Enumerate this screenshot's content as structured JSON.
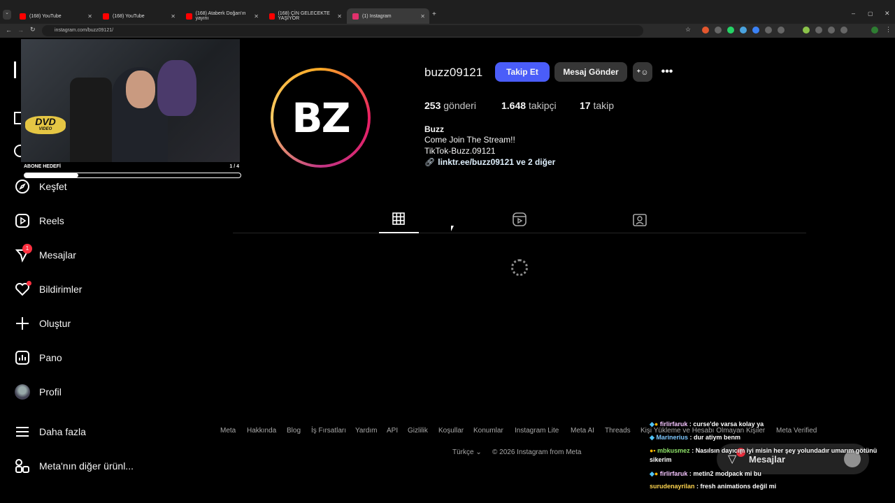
{
  "browser": {
    "tabs": [
      {
        "title": "(168) YouTube",
        "color": "#ff0000"
      },
      {
        "title": "(168) YouTube",
        "color": "#ff0000"
      },
      {
        "title": "(168) Ataberk Doğan'ın yayını",
        "color": "#ff0000"
      },
      {
        "title": "(168) ÇİN GELECEKTE YAŞIYOR",
        "color": "#ff0000"
      },
      {
        "title": "(1) Instagram",
        "color": "#e1306c"
      }
    ],
    "url": "instagram.com/buzz09121/"
  },
  "stream": {
    "dvd_label": "DVD",
    "dvd_sub": "VIDEO",
    "goal_label": "ABONE HEDEFİ",
    "goal_count": "1 / 4",
    "goal_progress": 0.25
  },
  "sidebar": {
    "items": [
      {
        "label": "Keşfet",
        "icon": "compass-icon"
      },
      {
        "label": "Reels",
        "icon": "reels-icon"
      },
      {
        "label": "Mesajlar",
        "icon": "messenger-icon",
        "badge": "1"
      },
      {
        "label": "Bildirimler",
        "icon": "heart-icon"
      },
      {
        "label": "Oluştur",
        "icon": "plus-icon"
      },
      {
        "label": "Pano",
        "icon": "dashboard-icon"
      },
      {
        "label": "Profil",
        "icon": "avatar"
      },
      {
        "label": "Daha fazla",
        "icon": "menu-icon"
      },
      {
        "label": "Meta'nın diğer ürünl...",
        "icon": "apps-icon"
      }
    ]
  },
  "profile": {
    "username": "buzz09121",
    "avatar_text": "BZ",
    "follow_label": "Takip Et",
    "message_label": "Mesaj Gönder",
    "posts_count": "253",
    "posts_label": "gönderi",
    "followers_count": "1.648",
    "followers_label": "takipçi",
    "following_count": "17",
    "following_label": "takip",
    "name": "Buzz",
    "bio_line1": "Come Join The Stream!!",
    "bio_line2": "TikTok-Buzz.09121",
    "link": "linktr.ee/buzz09121 ve 2 diğer"
  },
  "footer": {
    "links": [
      "Meta",
      "Hakkında",
      "Blog",
      "İş Fırsatları",
      "Yardım",
      "API",
      "Gizlilik",
      "Koşullar",
      "Konumlar",
      "Instagram Lite",
      "Meta AI",
      "Threads",
      "Kişi Yükleme ve Hesabı Olmayan Kişiler",
      "Meta Verified"
    ],
    "language": "Türkçe",
    "copyright": "© 2026 Instagram from Meta"
  },
  "messages_popup": {
    "label": "Mesajlar",
    "badge": "1"
  },
  "chat": [
    {
      "user": "firlirfaruk",
      "text": ": curse'de varsa kolay ya"
    },
    {
      "user": "Marinerius",
      "text": ": dur atiym benm"
    },
    {
      "user": "mbkusmez",
      "text": ": Nasılsın dayıcım iyi misin her şey yolundadır umarım götünü sikerim"
    },
    {
      "user": "firlirfaruk",
      "text": ": metin2 modpack mi bu"
    },
    {
      "user": "surudenayrilan",
      "text": ": fresh animations değil mi"
    }
  ]
}
